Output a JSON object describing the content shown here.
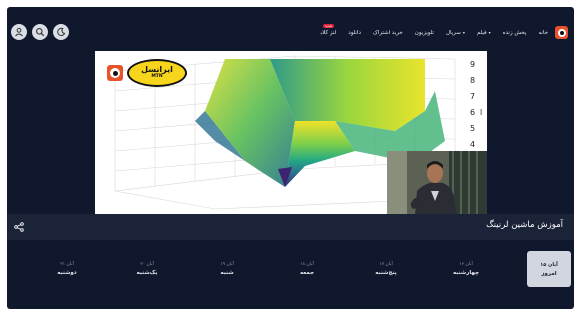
{
  "header": {
    "nav": [
      {
        "label": "خانه"
      },
      {
        "label": "پخش زنده"
      },
      {
        "label": "فیلم",
        "dropdown": true
      },
      {
        "label": "سریال",
        "dropdown": true
      },
      {
        "label": "تلویزیون"
      },
      {
        "label": "خرید اشتراک"
      },
      {
        "label": "دانلود"
      },
      {
        "label": "لنز کلاب",
        "badge": "جدید"
      }
    ],
    "icons": [
      "user-icon",
      "search-icon",
      "theme-toggle-icon"
    ]
  },
  "player": {
    "watermark": {
      "brand": "ایرانسل",
      "sub": "MTN"
    },
    "axis_ticks": [
      "9",
      "8",
      "7",
      "6",
      "5",
      "4"
    ],
    "axis_letter": "l"
  },
  "program": {
    "title": "آموزش ماشین لرنینگ"
  },
  "days": [
    {
      "date": "۱۵ آبان",
      "name": "امروز",
      "active": true
    },
    {
      "date": "۱۶ آبان",
      "name": "چهارشنبه"
    },
    {
      "date": "۱۷ آبان",
      "name": "پنج‌شنبه"
    },
    {
      "date": "۱۸ آبان",
      "name": "جمعه"
    },
    {
      "date": "۱۹ آبان",
      "name": "شنبه"
    },
    {
      "date": "۲۰ آبان",
      "name": "یک‌شنبه"
    },
    {
      "date": "۲۱ آبان",
      "name": "دوشنبه"
    }
  ],
  "colors": {
    "background": "#10182d",
    "panel": "#1a2338",
    "accent": "#e8532c",
    "badge": "#e0243c",
    "active_day": "#d2d6de"
  }
}
